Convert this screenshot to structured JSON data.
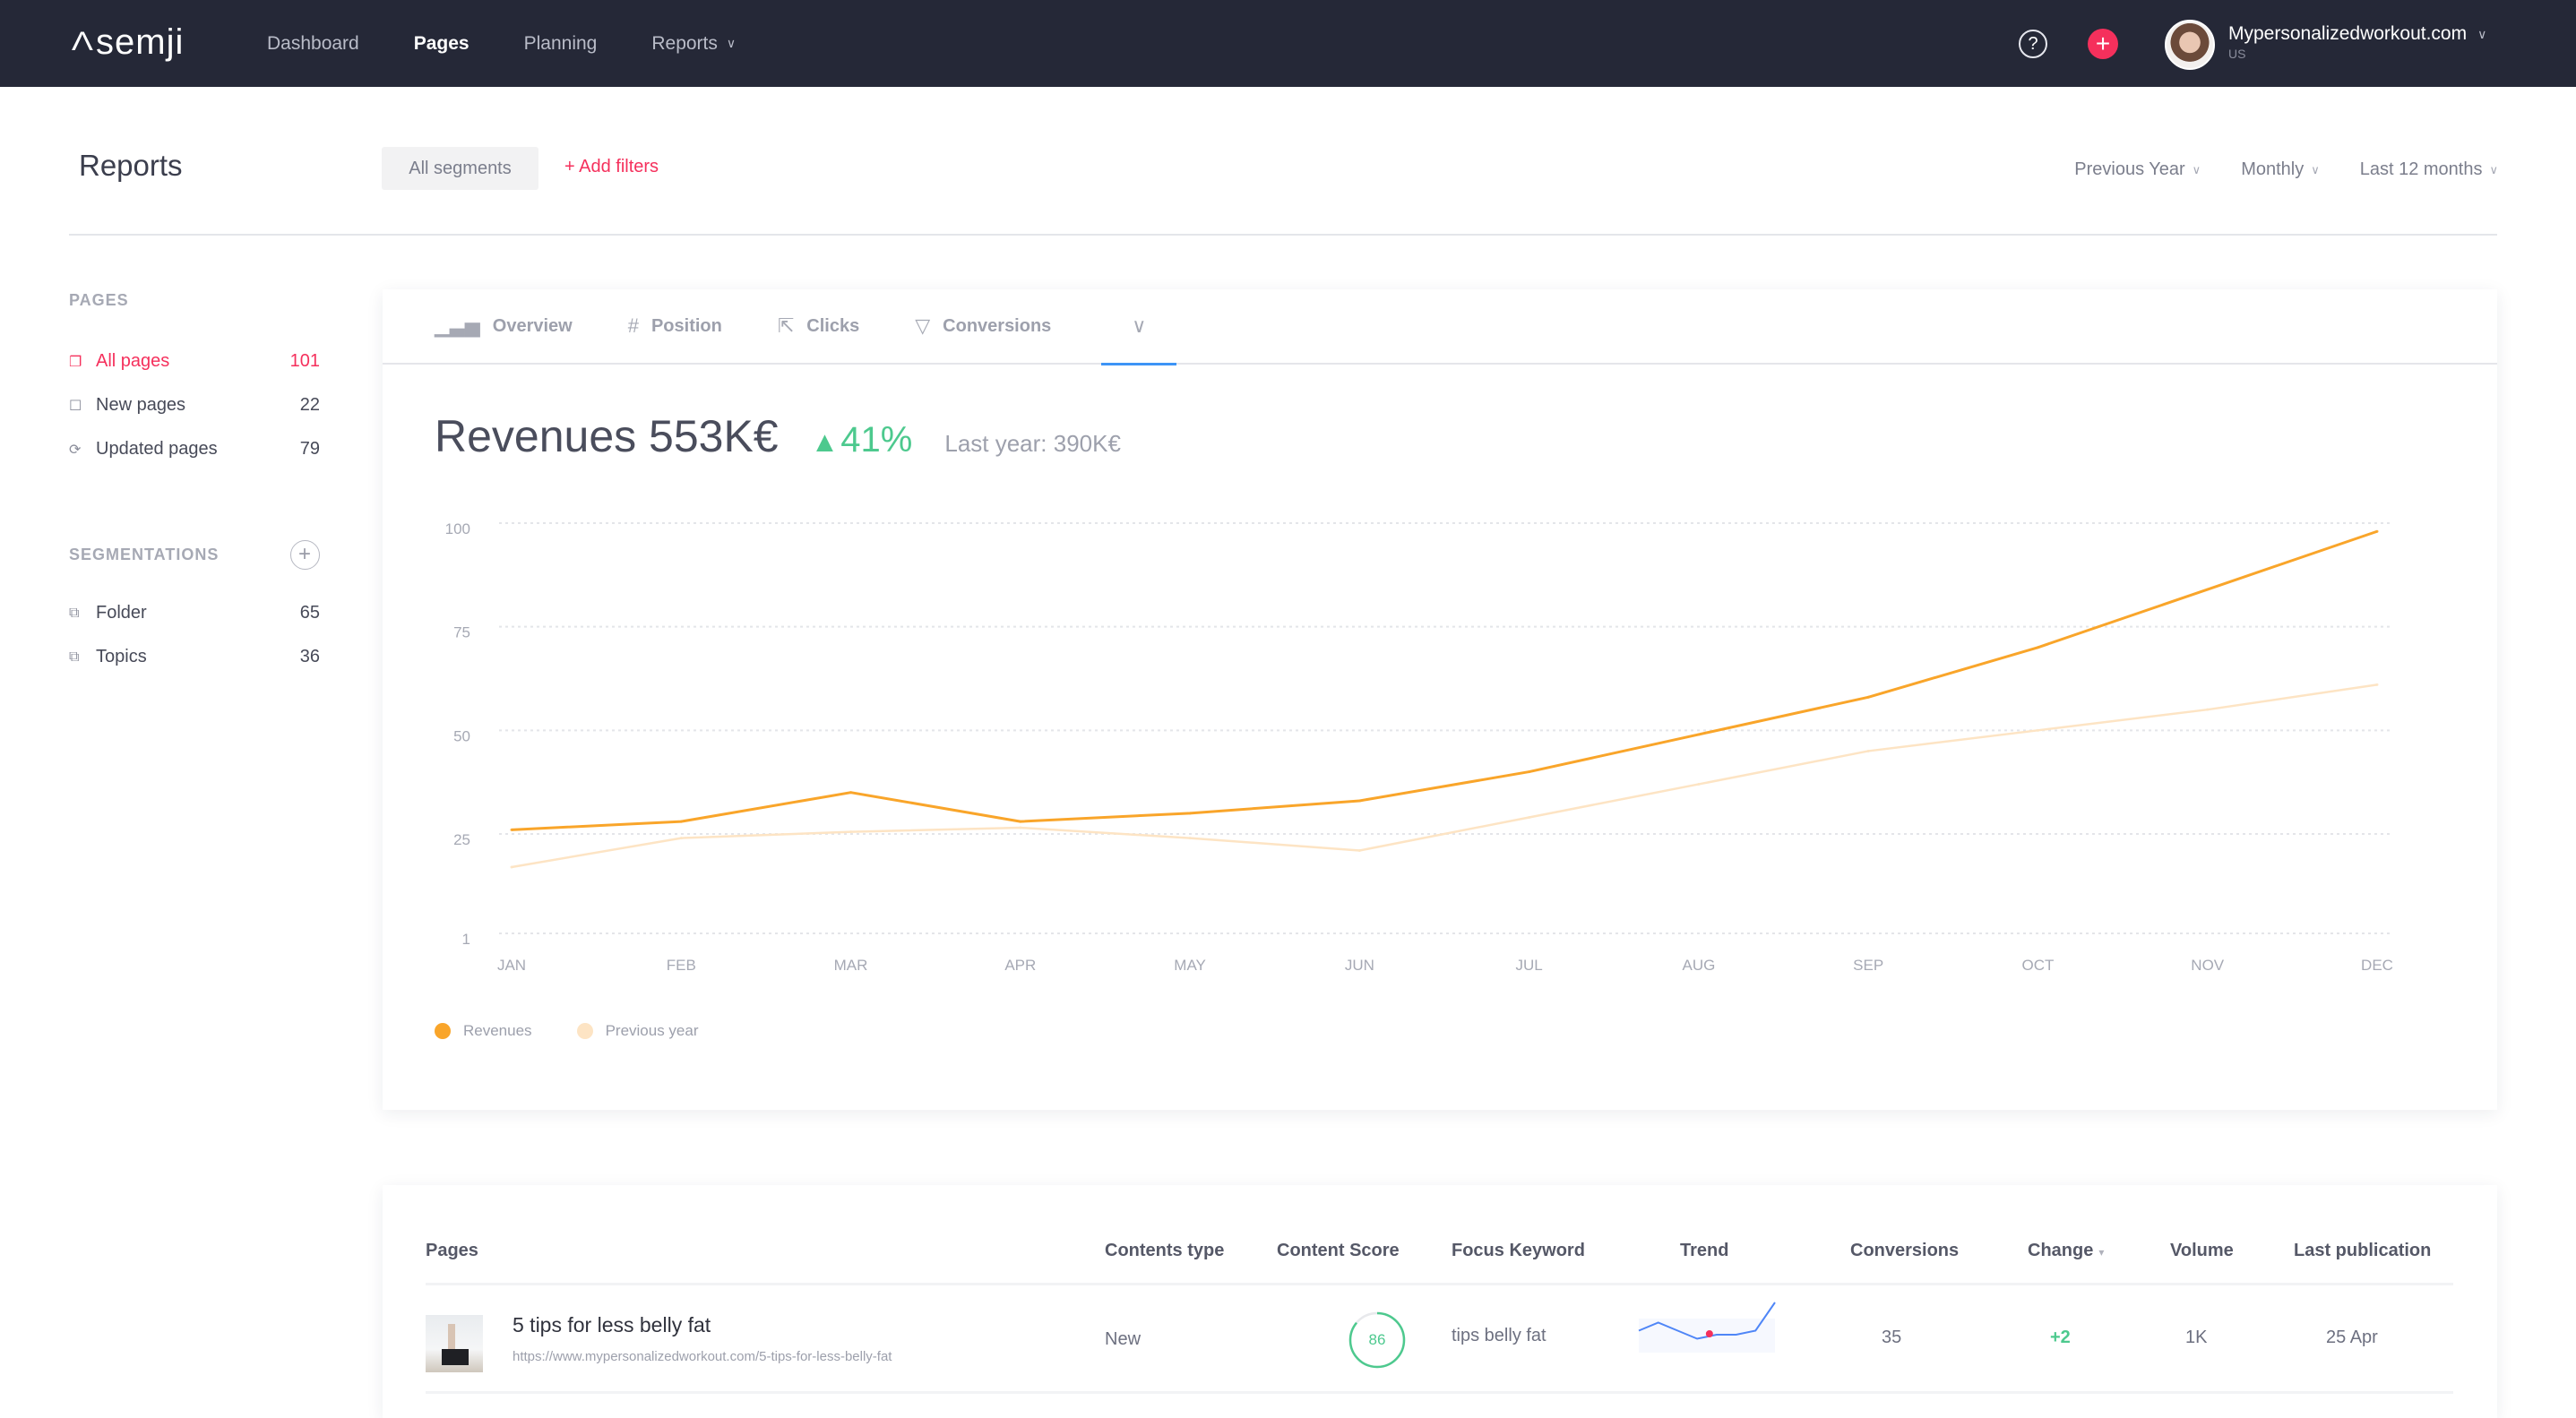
{
  "header": {
    "logo": "semji",
    "nav": [
      {
        "label": "Dashboard",
        "active": false
      },
      {
        "label": "Pages",
        "active": true
      },
      {
        "label": "Planning",
        "active": false
      },
      {
        "label": "Reports",
        "active": false,
        "has_dropdown": true
      }
    ],
    "help_icon": "question-circle-icon",
    "add_icon": "plus-icon",
    "account": {
      "name": "Mypersonalizedworkout.com",
      "country": "US"
    },
    "colors": {
      "bar_bg": "#252837",
      "accent": "#f5305c"
    }
  },
  "toolbar": {
    "title": "Reports",
    "segments_button": "All segments",
    "add_filters": "+ Add filters",
    "dropdowns": [
      "Previous Year",
      "Monthly",
      "Last 12 months"
    ]
  },
  "sidebar": {
    "pages_heading": "PAGES",
    "pages": [
      {
        "label": "All pages",
        "count": "101",
        "icon": "pages-icon",
        "active": true
      },
      {
        "label": "New pages",
        "count": "22",
        "icon": "file-icon",
        "active": false
      },
      {
        "label": "Updated pages",
        "count": "79",
        "icon": "refresh-icon",
        "active": false
      }
    ],
    "segmentations_heading": "SEGMENTATIONS",
    "segmentations": [
      {
        "label": "Folder",
        "count": "65",
        "icon": "stack-icon"
      },
      {
        "label": "Topics",
        "count": "36",
        "icon": "stack-icon"
      }
    ]
  },
  "tabs": [
    {
      "label": "Overview",
      "icon": "bar-chart-icon"
    },
    {
      "label": "Position",
      "icon": "hash-icon"
    },
    {
      "label": "Clicks",
      "icon": "cursor-icon"
    },
    {
      "label": "Conversions",
      "icon": "funnel-icon"
    },
    {
      "label": "",
      "icon": "chevron-down-icon",
      "active": true
    }
  ],
  "kpi": {
    "title": "Revenues 553K€",
    "delta": "41%",
    "delta_arrow": "▲",
    "last_year": "Last year: 390K€"
  },
  "chart_data": {
    "type": "line",
    "title": "Revenues 553K€",
    "categories": [
      "JAN",
      "FEB",
      "MAR",
      "APR",
      "MAY",
      "JUN",
      "JUL",
      "AUG",
      "SEP",
      "OCT",
      "NOV",
      "DEC"
    ],
    "yticks": [
      1,
      25,
      50,
      75,
      100
    ],
    "ylim": [
      1,
      100
    ],
    "grid": true,
    "legend_position": "bottom-left",
    "xlabel": "",
    "ylabel": "",
    "series": [
      {
        "name": "Revenues",
        "color": "#f9a52a",
        "values": [
          26,
          28,
          35,
          28,
          30,
          33,
          40,
          49,
          58,
          70,
          84,
          98
        ]
      },
      {
        "name": "Previous year",
        "color": "#fde4c4",
        "values": [
          17,
          24,
          25.5,
          26.5,
          24,
          21,
          29,
          37,
          45,
          50,
          55,
          61
        ]
      }
    ]
  },
  "table": {
    "columns": [
      "Pages",
      "Contents type",
      "Content Score",
      "Focus Keyword",
      "Trend",
      "Conversions",
      "Change",
      "Volume",
      "Last publication"
    ],
    "sort_column": "Change",
    "rows": [
      {
        "title": "5 tips for less belly fat",
        "url": "https://www.mypersonalizedworkout.com/5-tips-for-less-belly-fat",
        "contents_type": "New",
        "content_score": 86,
        "focus_keyword": "tips belly fat",
        "trend": [
          5,
          7,
          5,
          3,
          4,
          4,
          5,
          12
        ],
        "trend_highlight_index": 4,
        "conversions": "35",
        "change": "+2",
        "volume": "1K",
        "last_publication": "25 Apr"
      }
    ]
  }
}
